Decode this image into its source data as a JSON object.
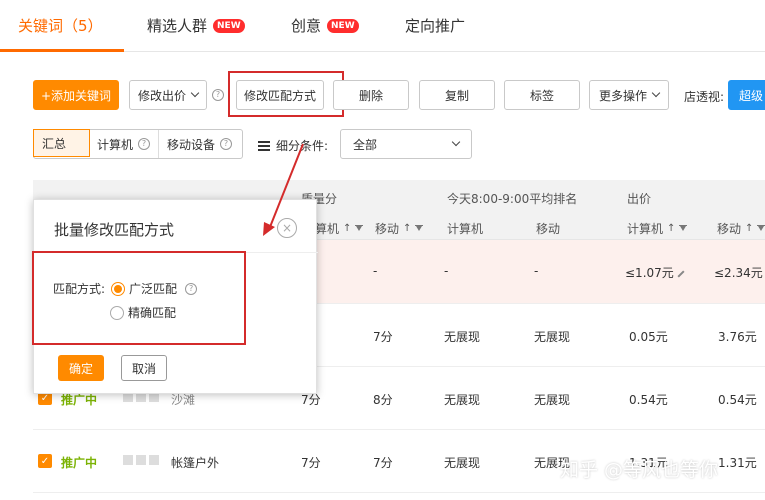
{
  "tabs": [
    {
      "label": "关键词（5）"
    },
    {
      "label": "精选人群",
      "badge": "NEW"
    },
    {
      "label": "创意",
      "badge": "NEW"
    },
    {
      "label": "定向推广"
    }
  ],
  "toolbar": {
    "add_keyword": "+添加关键词",
    "modify_bid": "修改出价",
    "modify_match": "修改匹配方式",
    "delete": "删除",
    "copy": "复制",
    "tag": "标签",
    "more_ops": "更多操作",
    "store_view_label": "店透视:",
    "super_partial": "超级"
  },
  "segments": [
    {
      "label": "汇总"
    },
    {
      "label": "计算机"
    },
    {
      "label": "移动设备"
    }
  ],
  "filter": {
    "label": "细分条件:",
    "value": "全部"
  },
  "table": {
    "groups": {
      "quality": "质量分",
      "rank": "今天8:00-9:00平均排名",
      "bid": "出价"
    },
    "subheaders": {
      "quality_pc": "算机",
      "quality_mobile": "移动",
      "rank_pc": "计算机",
      "rank_mobile": "移动",
      "bid_pc": "计算机",
      "bid_mobile": "移动"
    },
    "summary": {
      "q_mobile": "-",
      "rank_pc": "-",
      "rank_mobile": "-",
      "bid_pc": "≤1.07元",
      "bid_mobile": "≤2.34元"
    },
    "rows": [
      {
        "q_pc": "-",
        "q_mobile": "7分",
        "rank_pc": "无展现",
        "rank_mobile": "无展现",
        "bid_pc": "0.05元",
        "bid_mobile": "3.76元"
      },
      {
        "status": "推广中",
        "keyword": "沙滩",
        "q_pc": "7分",
        "q_mobile": "8分",
        "rank_pc": "无展现",
        "rank_mobile": "无展现",
        "bid_pc": "0.54元",
        "bid_mobile": "0.54元"
      },
      {
        "status": "推广中",
        "keyword": "帐篷户外",
        "q_pc": "7分",
        "q_mobile": "7分",
        "rank_pc": "无展现",
        "rank_mobile": "无展现",
        "bid_pc": "1.31元",
        "bid_mobile": "1.31元"
      }
    ]
  },
  "popup": {
    "title": "批量修改匹配方式",
    "match_label": "匹配方式:",
    "option_broad": "广泛匹配",
    "option_exact": "精确匹配",
    "selected": "广泛匹配",
    "ok": "确定",
    "cancel": "取消"
  },
  "watermark": "知乎 @等风也等你",
  "colors": {
    "accent": "#ff8a00",
    "highlight_box": "#d42b2b",
    "status_green": "#7cb305"
  }
}
